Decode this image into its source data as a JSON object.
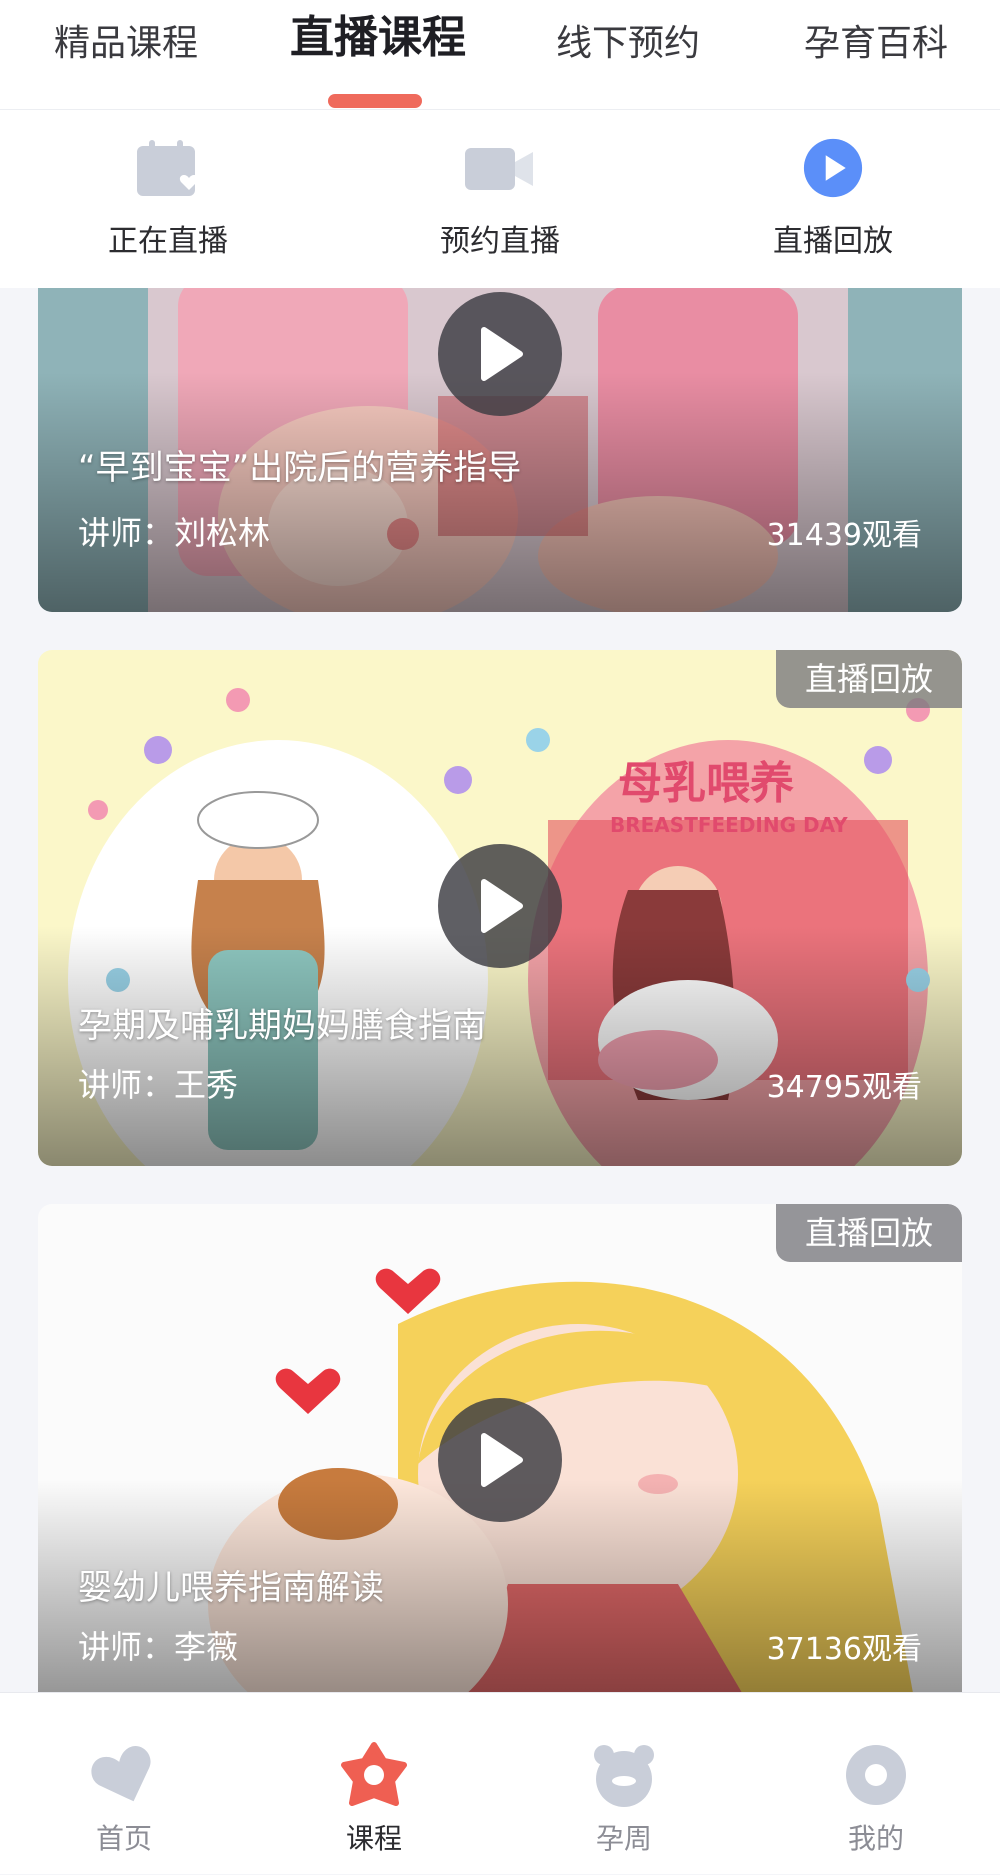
{
  "top_tabs": [
    {
      "label": "精品课程"
    },
    {
      "label": "直播课程",
      "active": true
    },
    {
      "label": "线下预约"
    },
    {
      "label": "孕育百科"
    }
  ],
  "sub_tabs": [
    {
      "label": "正在直播",
      "icon": "calendar-icon"
    },
    {
      "label": "预约直播",
      "icon": "video-camera-icon"
    },
    {
      "label": "直播回放",
      "icon": "play-circle-icon"
    }
  ],
  "courses": [
    {
      "title": "“早到宝宝”出院后的营养指导",
      "lecturer": "讲师：刘松林",
      "views": "31439观看",
      "badge": ""
    },
    {
      "title": "孕期及哺乳期妈妈膳食指南",
      "lecturer": "讲师：王秀",
      "views": "34795观看",
      "badge": "直播回放",
      "art_title": "母乳喂养",
      "art_subtitle": "BREASTFEEDING DAY"
    },
    {
      "title": "婴幼儿喂养指南解读",
      "lecturer": "讲师：李薇",
      "views": "37136观看",
      "badge": "直播回放"
    }
  ],
  "bottom_nav": [
    {
      "label": "首页",
      "icon": "home-icon"
    },
    {
      "label": "课程",
      "icon": "course-star-icon",
      "active": true
    },
    {
      "label": "孕周",
      "icon": "pregnancy-week-icon"
    },
    {
      "label": "我的",
      "icon": "profile-icon"
    }
  ],
  "colors": {
    "accent": "#ef6a5c",
    "play_blue": "#5b8ff9",
    "icon_gray": "#c9ced9"
  }
}
